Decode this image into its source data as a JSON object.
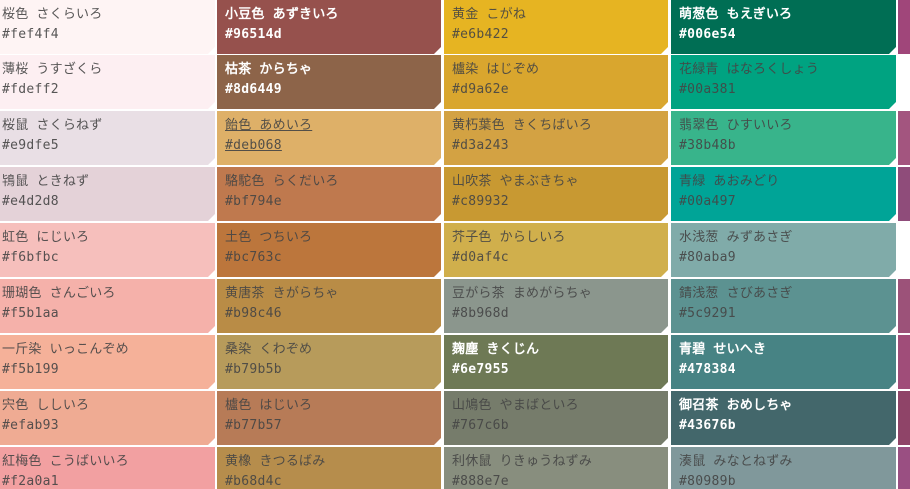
{
  "columns": [
    {
      "cells": [
        {
          "name": "桜色 さくらいろ",
          "hex": "#fef4f4",
          "color": "#fef4f4",
          "tone": "light"
        },
        {
          "name": "薄桜 うすざくら",
          "hex": "#fdeff2",
          "color": "#fdeff2",
          "tone": "light"
        },
        {
          "name": "桜鼠 さくらねず",
          "hex": "#e9dfe5",
          "color": "#e9dfe5",
          "tone": "light"
        },
        {
          "name": "鴇鼠 ときねず",
          "hex": "#e4d2d8",
          "color": "#e4d2d8",
          "tone": "light"
        },
        {
          "name": "虹色 にじいろ",
          "hex": "#f6bfbc",
          "color": "#f6bfbc",
          "tone": "light"
        },
        {
          "name": "珊瑚色 さんごいろ",
          "hex": "#f5b1aa",
          "color": "#f5b1aa",
          "tone": "light"
        },
        {
          "name": "一斤染 いっこんぞめ",
          "hex": "#f5b199",
          "color": "#f5b199",
          "tone": "light"
        },
        {
          "name": "宍色 ししいろ",
          "hex": "#efab93",
          "color": "#efab93",
          "tone": "light"
        },
        {
          "name": "紅梅色 こうばいいろ",
          "hex": "#f2a0a1",
          "color": "#f2a0a1",
          "tone": "light"
        }
      ]
    },
    {
      "cells": [
        {
          "name": "小豆色 あずきいろ",
          "hex": "#96514d",
          "color": "#96514d",
          "tone": "dark"
        },
        {
          "name": "枯茶 からちゃ",
          "hex": "#8d6449",
          "color": "#8d6449",
          "tone": "dark"
        },
        {
          "name": "飴色 あめいろ",
          "hex": "#deb068",
          "color": "#deb068",
          "tone": "light",
          "hover": true
        },
        {
          "name": "駱駝色 らくだいろ",
          "hex": "#bf794e",
          "color": "#bf794e",
          "tone": "light"
        },
        {
          "name": "土色 つちいろ",
          "hex": "#bc763c",
          "color": "#bc763c",
          "tone": "light"
        },
        {
          "name": "黄唐茶 きがらちゃ",
          "hex": "#b98c46",
          "color": "#b98c46",
          "tone": "light"
        },
        {
          "name": "桑染 くわぞめ",
          "hex": "#b79b5b",
          "color": "#b79b5b",
          "tone": "light"
        },
        {
          "name": "櫨色 はじいろ",
          "hex": "#b77b57",
          "color": "#b77b57",
          "tone": "light"
        },
        {
          "name": "黄橡 きつるばみ",
          "hex": "#b68d4c",
          "color": "#b68d4c",
          "tone": "light"
        }
      ]
    },
    {
      "cells": [
        {
          "name": "黄金 こがね",
          "hex": "#e6b422",
          "color": "#e6b422",
          "tone": "light"
        },
        {
          "name": "櫨染 はじぞめ",
          "hex": "#d9a62e",
          "color": "#d9a62e",
          "tone": "light"
        },
        {
          "name": "黄朽葉色 きくちばいろ",
          "hex": "#d3a243",
          "color": "#d3a243",
          "tone": "light"
        },
        {
          "name": "山吹茶 やまぶきちゃ",
          "hex": "#c89932",
          "color": "#c89932",
          "tone": "light"
        },
        {
          "name": "芥子色 からしいろ",
          "hex": "#d0af4c",
          "color": "#d0af4c",
          "tone": "light"
        },
        {
          "name": "豆がら茶 まめがらちゃ",
          "hex": "#8b968d",
          "color": "#8b968d",
          "tone": "light"
        },
        {
          "name": "麹塵 きくじん",
          "hex": "#6e7955",
          "color": "#6e7955",
          "tone": "dark"
        },
        {
          "name": "山鳩色 やまばといろ",
          "hex": "#767c6b",
          "color": "#767c6b",
          "tone": "light"
        },
        {
          "name": "利休鼠 りきゅうねずみ",
          "hex": "#888e7e",
          "color": "#888e7e",
          "tone": "light"
        }
      ]
    },
    {
      "cells": [
        {
          "name": "萌葱色 もえぎいろ",
          "hex": "#006e54",
          "color": "#006e54",
          "tone": "dark"
        },
        {
          "name": "花緑青 はなろくしょう",
          "hex": "#00a381",
          "color": "#00a381",
          "tone": "light"
        },
        {
          "name": "翡翠色 ひすいいろ",
          "hex": "#38b48b",
          "color": "#38b48b",
          "tone": "light"
        },
        {
          "name": "青緑 あおみどり",
          "hex": "#00a497",
          "color": "#00a497",
          "tone": "light"
        },
        {
          "name": "水浅葱 みずあさぎ",
          "hex": "#80aba9",
          "color": "#80aba9",
          "tone": "light"
        },
        {
          "name": "錆浅葱 さびあさぎ",
          "hex": "#5c9291",
          "color": "#5c9291",
          "tone": "light"
        },
        {
          "name": "青碧 せいへき",
          "hex": "#478384",
          "color": "#478384",
          "tone": "dark"
        },
        {
          "name": "御召茶 おめしちゃ",
          "hex": "#43676b",
          "color": "#43676b",
          "tone": "dark"
        },
        {
          "name": "湊鼠 みなとねずみ",
          "hex": "#80989b",
          "color": "#80989b",
          "tone": "light"
        }
      ]
    }
  ],
  "edge_strip": [
    {
      "color": "#a0467a"
    },
    {
      "color": "#ffffff"
    },
    {
      "color": "#a3557f"
    },
    {
      "color": "#8f4c7a"
    },
    {
      "color": "#ffffff"
    },
    {
      "color": "#9c5279"
    },
    {
      "color": "#a04d79"
    },
    {
      "color": "#8f4468"
    },
    {
      "color": "#9a4f82"
    }
  ]
}
